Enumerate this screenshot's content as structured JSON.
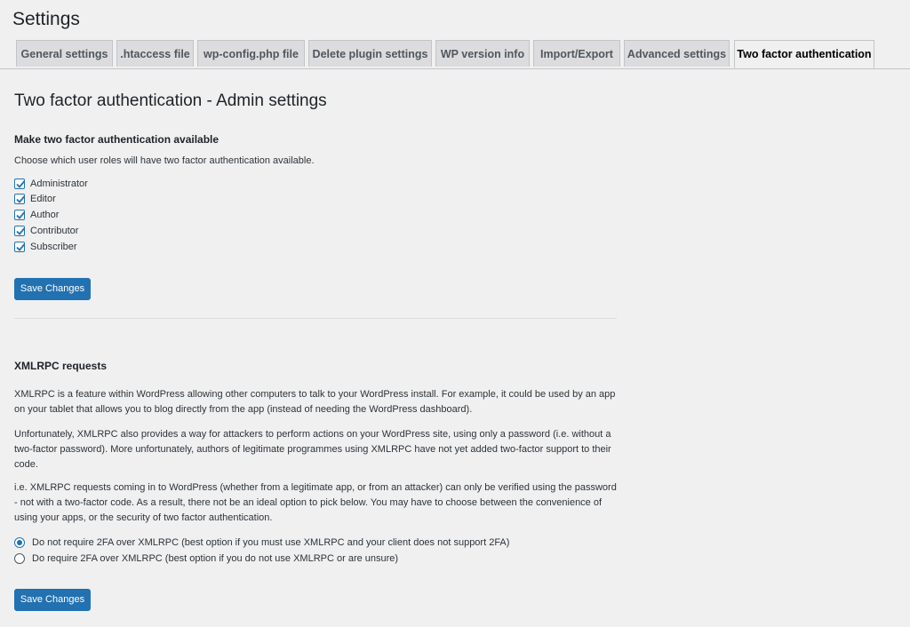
{
  "page": {
    "title": "Settings"
  },
  "tabs": [
    {
      "label": "General settings",
      "active": false
    },
    {
      "label": ".htaccess file",
      "active": false
    },
    {
      "label": "wp-config.php file",
      "active": false
    },
    {
      "label": "Delete plugin settings",
      "active": false
    },
    {
      "label": "WP version info",
      "active": false
    },
    {
      "label": "Import/Export",
      "active": false
    },
    {
      "label": "Advanced settings",
      "active": false
    },
    {
      "label": "Two factor authentication",
      "active": true
    }
  ],
  "admin": {
    "heading": "Two factor authentication - Admin settings",
    "subheading": "Make two factor authentication available",
    "description": "Choose which user roles will have two factor authentication available.",
    "roles": [
      {
        "label": "Administrator",
        "checked": true
      },
      {
        "label": "Editor",
        "checked": true
      },
      {
        "label": "Author",
        "checked": true
      },
      {
        "label": "Contributor",
        "checked": true
      },
      {
        "label": "Subscriber",
        "checked": true
      }
    ],
    "save_label": "Save Changes"
  },
  "xmlrpc": {
    "heading": "XMLRPC requests",
    "para1": "XMLRPC is a feature within WordPress allowing other computers to talk to your WordPress install. For example, it could be used by an app on your tablet that allows you to blog directly from the app (instead of needing the WordPress dashboard).",
    "para2": "Unfortunately, XMLRPC also provides a way for attackers to perform actions on your WordPress site, using only a password (i.e. without a two-factor password). More unfortunately, authors of legitimate programmes using XMLRPC have not yet added two-factor support to their code.",
    "para3": "i.e. XMLRPC requests coming in to WordPress (whether from a legitimate app, or from an attacker) can only be verified using the password - not with a two-factor code. As a result, there not be an ideal option to pick below. You may have to choose between the convenience of using your apps, or the security of two factor authentication.",
    "options": [
      {
        "label": "Do not require 2FA over XMLRPC (best option if you must use XMLRPC and your client does not support 2FA)",
        "checked": true
      },
      {
        "label": "Do require 2FA over XMLRPC (best option if you do not use XMLRPC or are unsure)",
        "checked": false
      }
    ],
    "save_label": "Save Changes"
  },
  "colors": {
    "accent": "#2271b1",
    "background": "#f0f0f1",
    "tab_inactive": "#dcdcde"
  }
}
